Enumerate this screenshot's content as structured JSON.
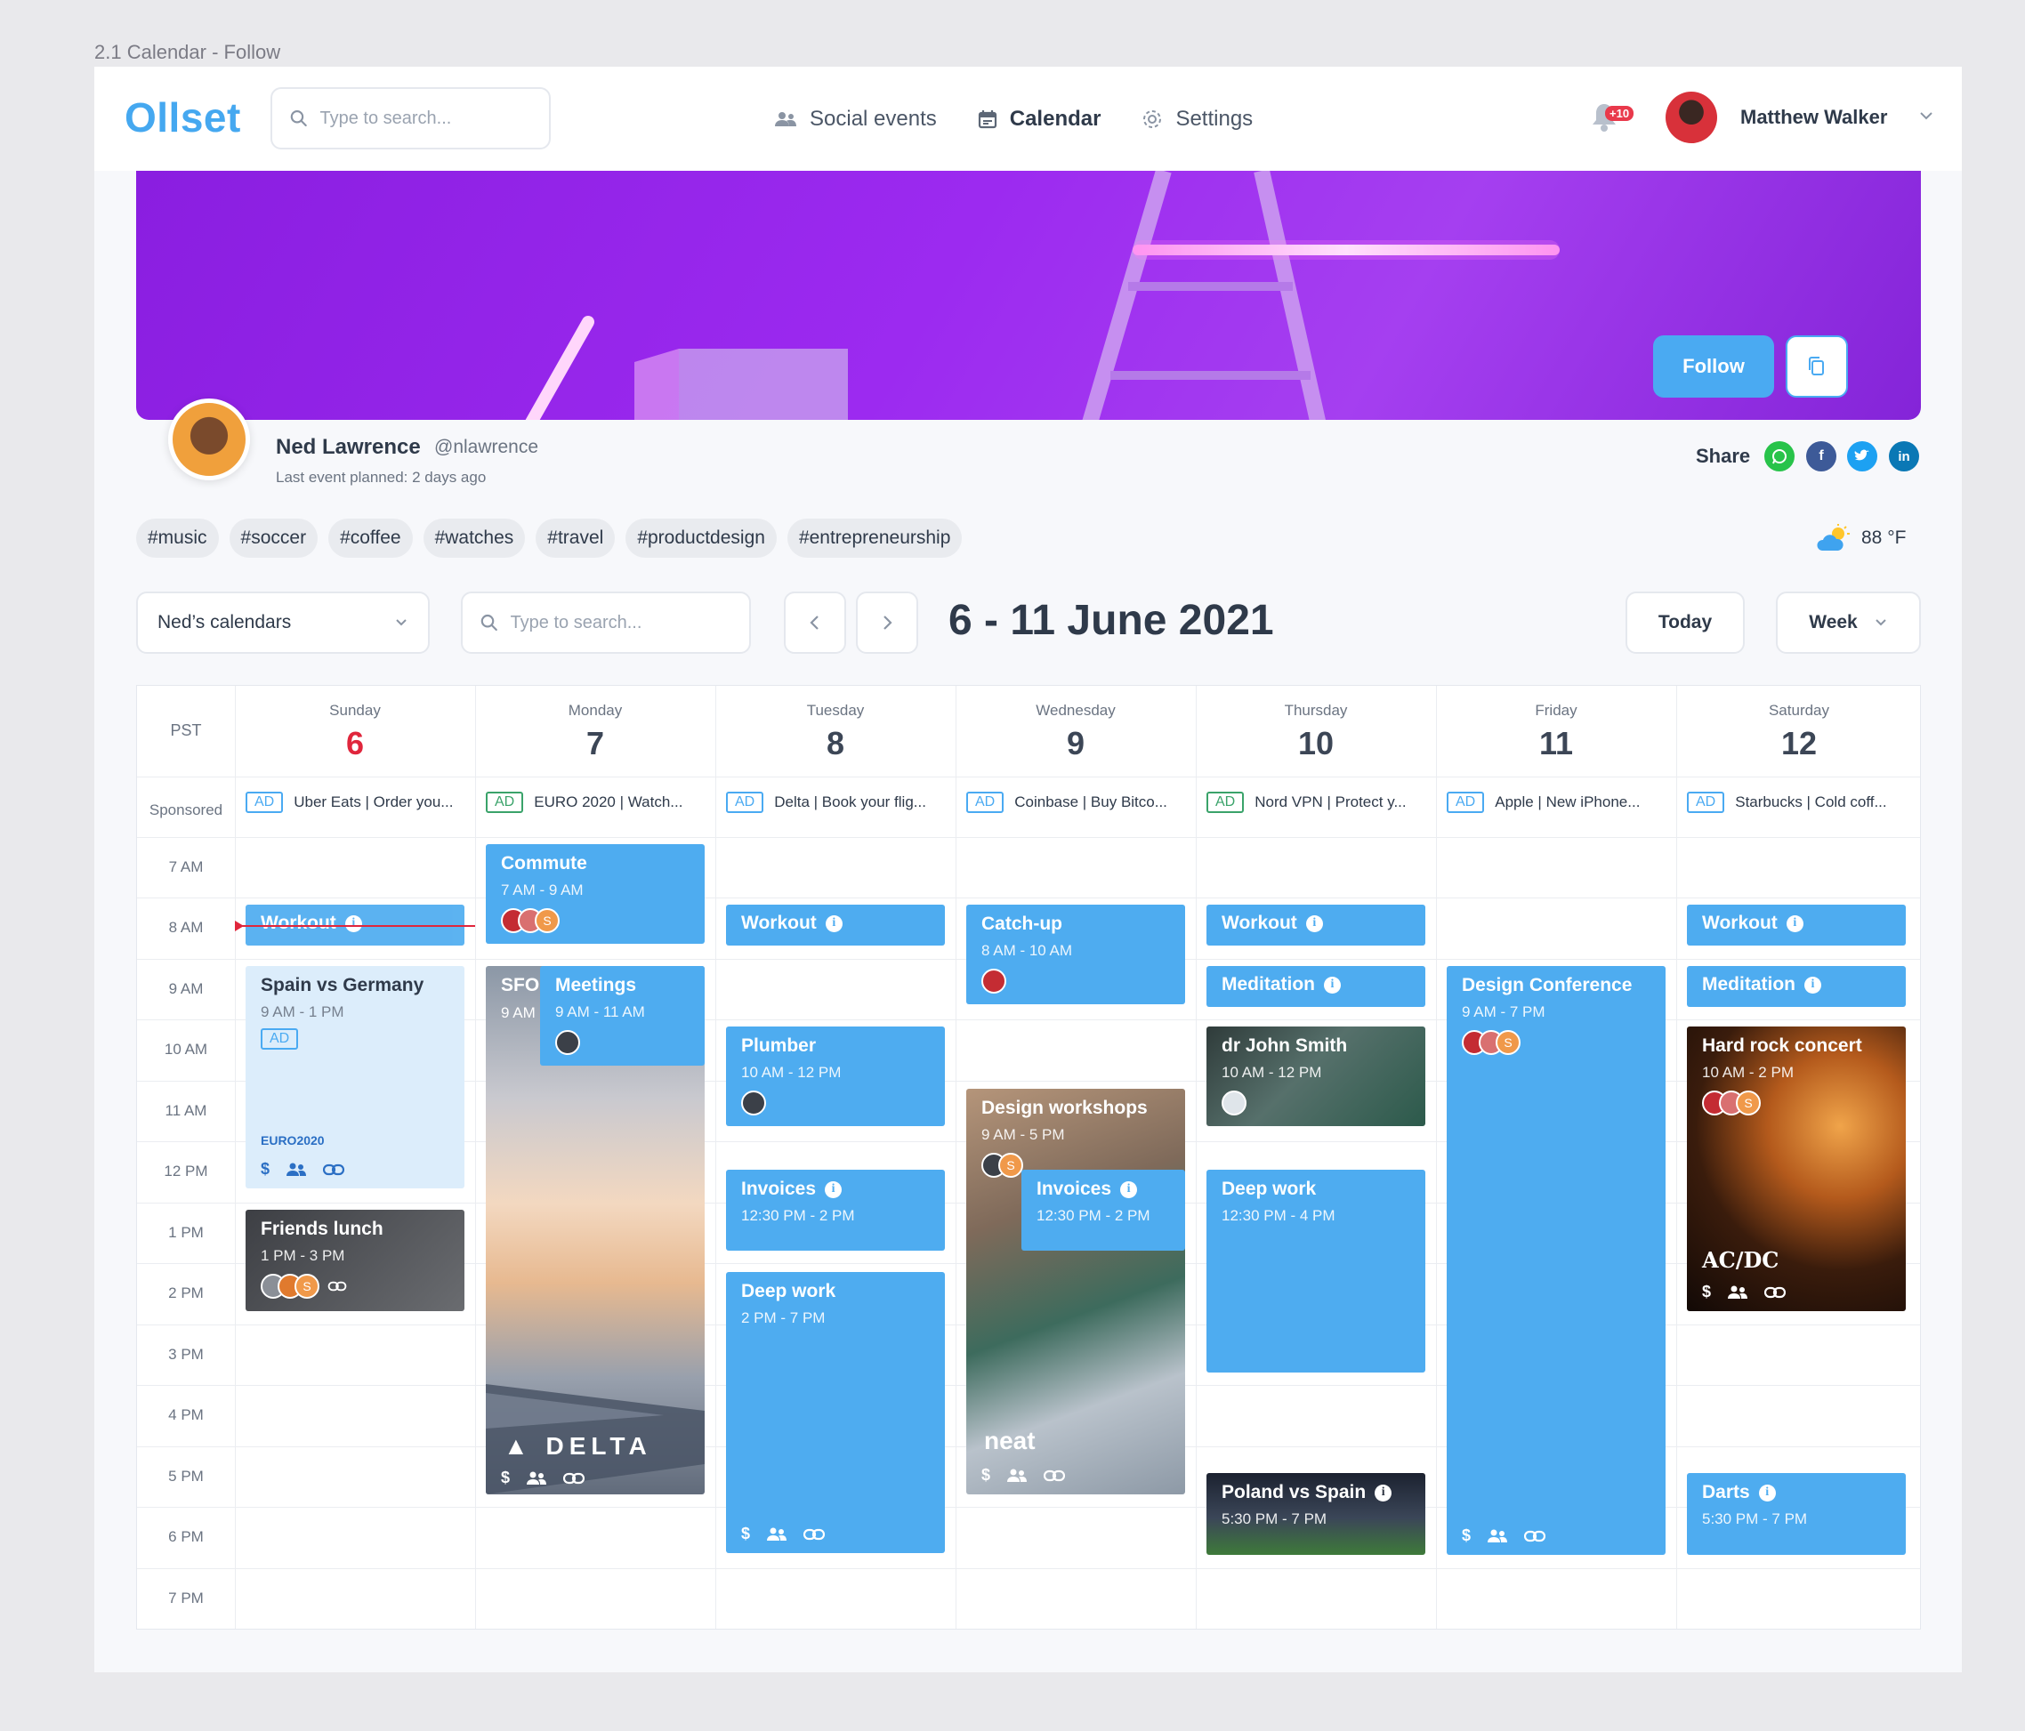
{
  "frame_label": "2.1 Calendar - Follow",
  "header": {
    "logo": "Ollset",
    "search_placeholder": "Type to search...",
    "nav": [
      {
        "label": "Social events",
        "icon": "people-icon"
      },
      {
        "label": "Calendar",
        "icon": "calendar-icon",
        "active": true
      },
      {
        "label": "Settings",
        "icon": "gear-icon"
      }
    ],
    "notifications_badge": "+10",
    "user_name": "Matthew Walker"
  },
  "banner": {
    "follow_label": "Follow"
  },
  "profile": {
    "name": "Ned Lawrence",
    "handle": "@nlawrence",
    "subtitle": "Last event planned: 2 days ago",
    "share_label": "Share",
    "share_icons": [
      "whatsapp-icon",
      "facebook-icon",
      "twitter-icon",
      "linkedin-icon"
    ]
  },
  "tags": [
    "#music",
    "#soccer",
    "#coffee",
    "#watches",
    "#travel",
    "#productdesign",
    "#entrepreneurship"
  ],
  "weather": {
    "temp": "88 °F",
    "icon": "partly-sunny-icon"
  },
  "toolbar": {
    "calendars_select": "Ned’s calendars",
    "search_placeholder": "Type to search...",
    "range_title": "6 - 11 June 2021",
    "today_label": "Today",
    "view_label": "Week"
  },
  "calendar": {
    "timezone": "PST",
    "sponsored_label": "Sponsored",
    "days": [
      {
        "name": "Sunday",
        "num": "6",
        "today": true,
        "ad": "Uber Eats | Order you..."
      },
      {
        "name": "Monday",
        "num": "7",
        "ad": "EURO 2020 | Watch..."
      },
      {
        "name": "Tuesday",
        "num": "8",
        "ad": "Delta | Book your flig..."
      },
      {
        "name": "Wednesday",
        "num": "9",
        "ad": "Coinbase | Buy Bitco..."
      },
      {
        "name": "Thursday",
        "num": "10",
        "ad": "Nord VPN | Protect y..."
      },
      {
        "name": "Friday",
        "num": "11",
        "ad": "Apple | New iPhone..."
      },
      {
        "name": "Saturday",
        "num": "12",
        "ad": "Starbucks | Cold coff..."
      }
    ],
    "ad_badge": "AD",
    "hours": [
      "7 AM",
      "8 AM",
      "9 AM",
      "10 AM",
      "11 AM",
      "12 PM",
      "1 PM",
      "2 PM",
      "3 PM",
      "4 PM",
      "5 PM",
      "6 PM",
      "7 PM"
    ],
    "events": {
      "sun_workout": {
        "title": "Workout"
      },
      "sun_spain": {
        "title": "Spain vs Germany",
        "time": "9 AM - 1 PM",
        "ad": "AD",
        "brand": "EURO2020"
      },
      "sun_lunch": {
        "title": "Friends lunch",
        "time": "1 PM - 3 PM"
      },
      "mon_commute": {
        "title": "Commute",
        "time": "7 AM - 9 AM"
      },
      "mon_sfo": {
        "title": "SFO",
        "time": "9 AM",
        "brand": "DELTA"
      },
      "mon_meetings": {
        "title": "Meetings",
        "time": "9 AM - 11 AM"
      },
      "tue_workout": {
        "title": "Workout"
      },
      "tue_plumber": {
        "title": "Plumber",
        "time": "10 AM - 12 PM"
      },
      "tue_invoices": {
        "title": "Invoices",
        "time": "12:30 PM - 2 PM"
      },
      "tue_deep": {
        "title": "Deep work",
        "time": "2 PM - 7 PM"
      },
      "wed_catchup": {
        "title": "Catch-up",
        "time": "8 AM - 10 AM"
      },
      "wed_design": {
        "title": "Design workshops",
        "time": "9 AM - 5 PM",
        "brand": "neat"
      },
      "wed_invoices": {
        "title": "Invoices",
        "time": "12:30 PM - 2 PM"
      },
      "thu_workout": {
        "title": "Workout"
      },
      "thu_meditation": {
        "title": "Meditation"
      },
      "thu_doctor": {
        "title": "dr John Smith",
        "time": "10 AM - 12 PM"
      },
      "thu_deep": {
        "title": "Deep work",
        "time": "12:30 PM - 4 PM"
      },
      "thu_poland": {
        "title": "Poland vs Spain",
        "time": "5:30 PM - 7 PM"
      },
      "fri_design": {
        "title": "Design Conference",
        "time": "9 AM - 7 PM"
      },
      "sat_workout": {
        "title": "Workout"
      },
      "sat_meditation": {
        "title": "Meditation"
      },
      "sat_concert": {
        "title": "Hard rock concert",
        "time": "10 AM - 2 PM",
        "brand": "AC/DC"
      },
      "sat_darts": {
        "title": "Darts",
        "time": "5:30 PM - 7 PM"
      }
    }
  },
  "colors": {
    "accent": "#4eacf0",
    "today": "#e0263c",
    "banner": "#9c2af0"
  }
}
